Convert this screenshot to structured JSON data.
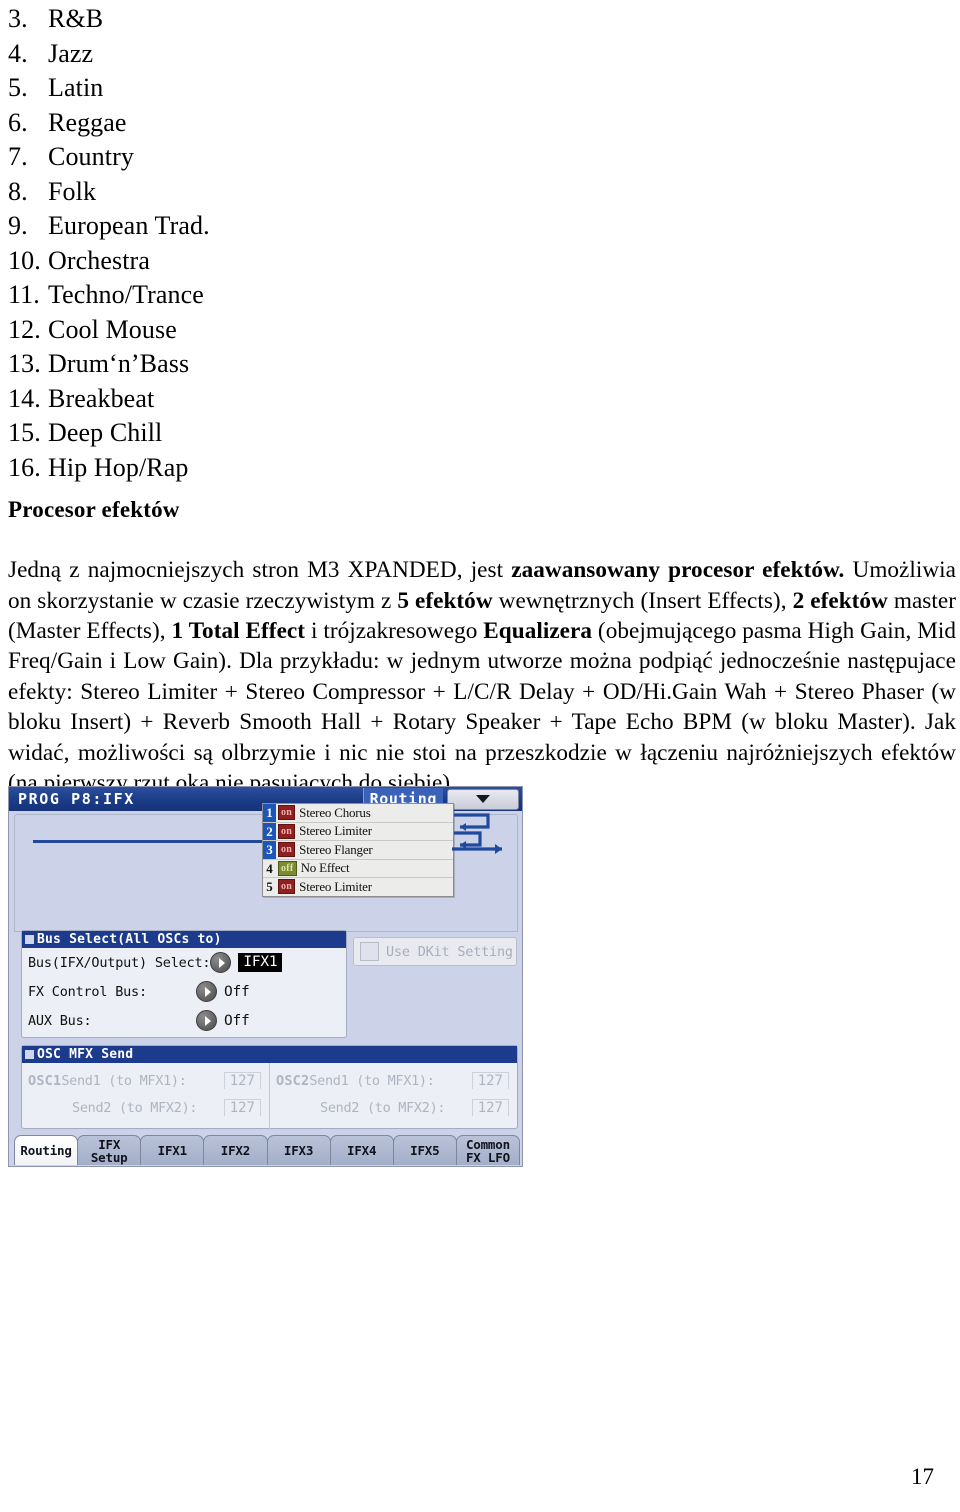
{
  "genre_list": [
    {
      "num": "3.",
      "label": "R&B"
    },
    {
      "num": "4.",
      "label": "Jazz"
    },
    {
      "num": "5.",
      "label": "Latin"
    },
    {
      "num": "6.",
      "label": "Reggae"
    },
    {
      "num": "7.",
      "label": "Country"
    },
    {
      "num": "8.",
      "label": "Folk"
    },
    {
      "num": "9.",
      "label": "European Trad."
    },
    {
      "num": "10.",
      "label": "Orchestra"
    },
    {
      "num": "11.",
      "label": "Techno/Trance"
    },
    {
      "num": "12.",
      "label": "Cool Mouse"
    },
    {
      "num": "13.",
      "label": "Drum‘n’Bass"
    },
    {
      "num": "14.",
      "label": "Breakbeat"
    },
    {
      "num": "15.",
      "label": "Deep Chill"
    },
    {
      "num": "16.",
      "label": "Hip Hop/Rap"
    }
  ],
  "section": {
    "heading": "Procesor efektów",
    "paragraph": {
      "p1": "Jedną z najmocniejszych stron M3 XPANDED, jest ",
      "b1": "zaawansowany procesor efektów.",
      "p2": " Umożliwia on skorzystanie w czasie rzeczywistym z ",
      "b2": "5 efektów",
      "p3": " wewnętrznych (Insert Effects), ",
      "b3": "2 efektów",
      "p4": " master (Master Effects), ",
      "b4": "1 Total Effect",
      "p5": " i trójzakresowego ",
      "b5": "Equalizera",
      "p6": " (obejmującego pasma High Gain, Mid Freq/Gain i Low Gain). Dla przykładu: w jednym utworze można podpiąć jednocześnie następujace efekty: Stereo Limiter + Stereo Compressor + L/C/R Delay + OD/Hi.Gain Wah + Stereo Phaser (w bloku Insert) + Reverb Smooth Hall + Rotary Speaker + Tape Echo BPM (w bloku Master). Jak widać, możliwości są olbrzymie i nic nie stoi na przeszkodzie w łączeniu najróżniejszych efektów (na pierwszy rzut oka nie pasujących do siebie)."
    }
  },
  "lcd": {
    "titlebar": {
      "title": "PROG P8:IFX",
      "page_name": "Routing",
      "menu_icon": "chevron-down-icon"
    },
    "effect_slots": [
      {
        "num": "1",
        "state": "on",
        "name": "Stereo Chorus",
        "selected": true
      },
      {
        "num": "2",
        "state": "on",
        "name": "Stereo Limiter",
        "selected": true
      },
      {
        "num": "3",
        "state": "on",
        "name": "Stereo Flanger",
        "selected": true
      },
      {
        "num": "4",
        "state": "off",
        "name": "No Effect",
        "selected": false
      },
      {
        "num": "5",
        "state": "on",
        "name": "Stereo Limiter",
        "selected": false
      }
    ],
    "bus_panel": {
      "title": "Bus Select(All OSCs to)",
      "rows": [
        {
          "label": "Bus(IFX/Output) Select:",
          "value": "IFX1",
          "inverted": true
        },
        {
          "label": "FX Control Bus:",
          "value": "Off",
          "inverted": false
        },
        {
          "label": "AUX Bus:",
          "value": "Off",
          "inverted": false
        }
      ]
    },
    "dkit": {
      "label": "Use DKit Setting",
      "checked": false
    },
    "mfx_panel": {
      "title": "OSC MFX Send",
      "columns": [
        {
          "osc": "OSC1",
          "rows": [
            {
              "label": "Send1 (to MFX1):",
              "value": "127"
            },
            {
              "label": "Send2 (to MFX2):",
              "value": "127"
            }
          ]
        },
        {
          "osc": "OSC2",
          "rows": [
            {
              "label": "Send1 (to MFX1):",
              "value": "127"
            },
            {
              "label": "Send2 (to MFX2):",
              "value": "127"
            }
          ]
        }
      ]
    },
    "tabs": [
      {
        "line1": "Routing",
        "line2": "",
        "active": true
      },
      {
        "line1": "IFX",
        "line2": "Setup",
        "active": false
      },
      {
        "line1": "IFX1",
        "line2": "",
        "active": false
      },
      {
        "line1": "IFX2",
        "line2": "",
        "active": false
      },
      {
        "line1": "IFX3",
        "line2": "",
        "active": false
      },
      {
        "line1": "IFX4",
        "line2": "",
        "active": false
      },
      {
        "line1": "IFX5",
        "line2": "",
        "active": false
      },
      {
        "line1": "Common",
        "line2": "FX LFO",
        "active": false
      }
    ]
  },
  "footer": {
    "page_number": "17"
  },
  "colors": {
    "lcd_background": "#ccd2e8",
    "titlebar_blue": "#1b3c86",
    "badge_on": "#8e2020",
    "badge_off": "#7d8a32",
    "selection_blue": "#1c56b8",
    "routing_line": "#23479b"
  }
}
